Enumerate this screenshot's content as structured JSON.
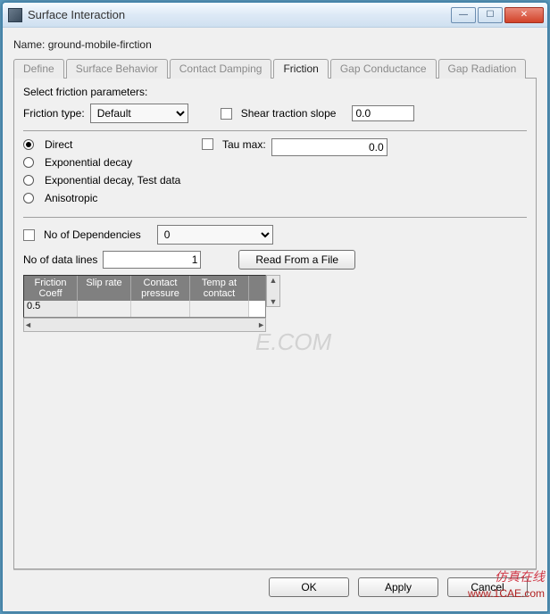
{
  "window": {
    "title": "Surface Interaction"
  },
  "name_label": "Name:",
  "name_value": "ground-mobile-firction",
  "tabs": {
    "items": [
      {
        "label": "Define"
      },
      {
        "label": "Surface Behavior"
      },
      {
        "label": "Contact Damping"
      },
      {
        "label": "Friction"
      },
      {
        "label": "Gap Conductance"
      },
      {
        "label": "Gap Radiation"
      }
    ],
    "active_index": 3
  },
  "friction": {
    "header": "Select friction parameters:",
    "type_label": "Friction type:",
    "type_value": "Default",
    "shear_label": "Shear traction slope",
    "shear_value": "0.0",
    "methods": [
      {
        "label": "Direct",
        "checked": true
      },
      {
        "label": "Exponential decay",
        "checked": false
      },
      {
        "label": "Exponential decay, Test data",
        "checked": false
      },
      {
        "label": "Anisotropic",
        "checked": false
      }
    ],
    "tau_label": "Tau max:",
    "tau_value": "0.0",
    "nodeps_label": "No of Dependencies",
    "nodeps_value": "0",
    "nlines_label": "No of data lines",
    "nlines_value": "1",
    "read_btn": "Read From a File",
    "columns": [
      "Friction Coeff",
      "Slip rate",
      "Contact pressure",
      "Temp at contact"
    ],
    "row0": {
      "c0": "0.5",
      "c1": "",
      "c2": "",
      "c3": ""
    }
  },
  "buttons": {
    "ok": "OK",
    "apply": "Apply",
    "cancel": "Cancel"
  },
  "watermark": {
    "brand": "仿真在线",
    "url": "www.1CAE.com"
  }
}
